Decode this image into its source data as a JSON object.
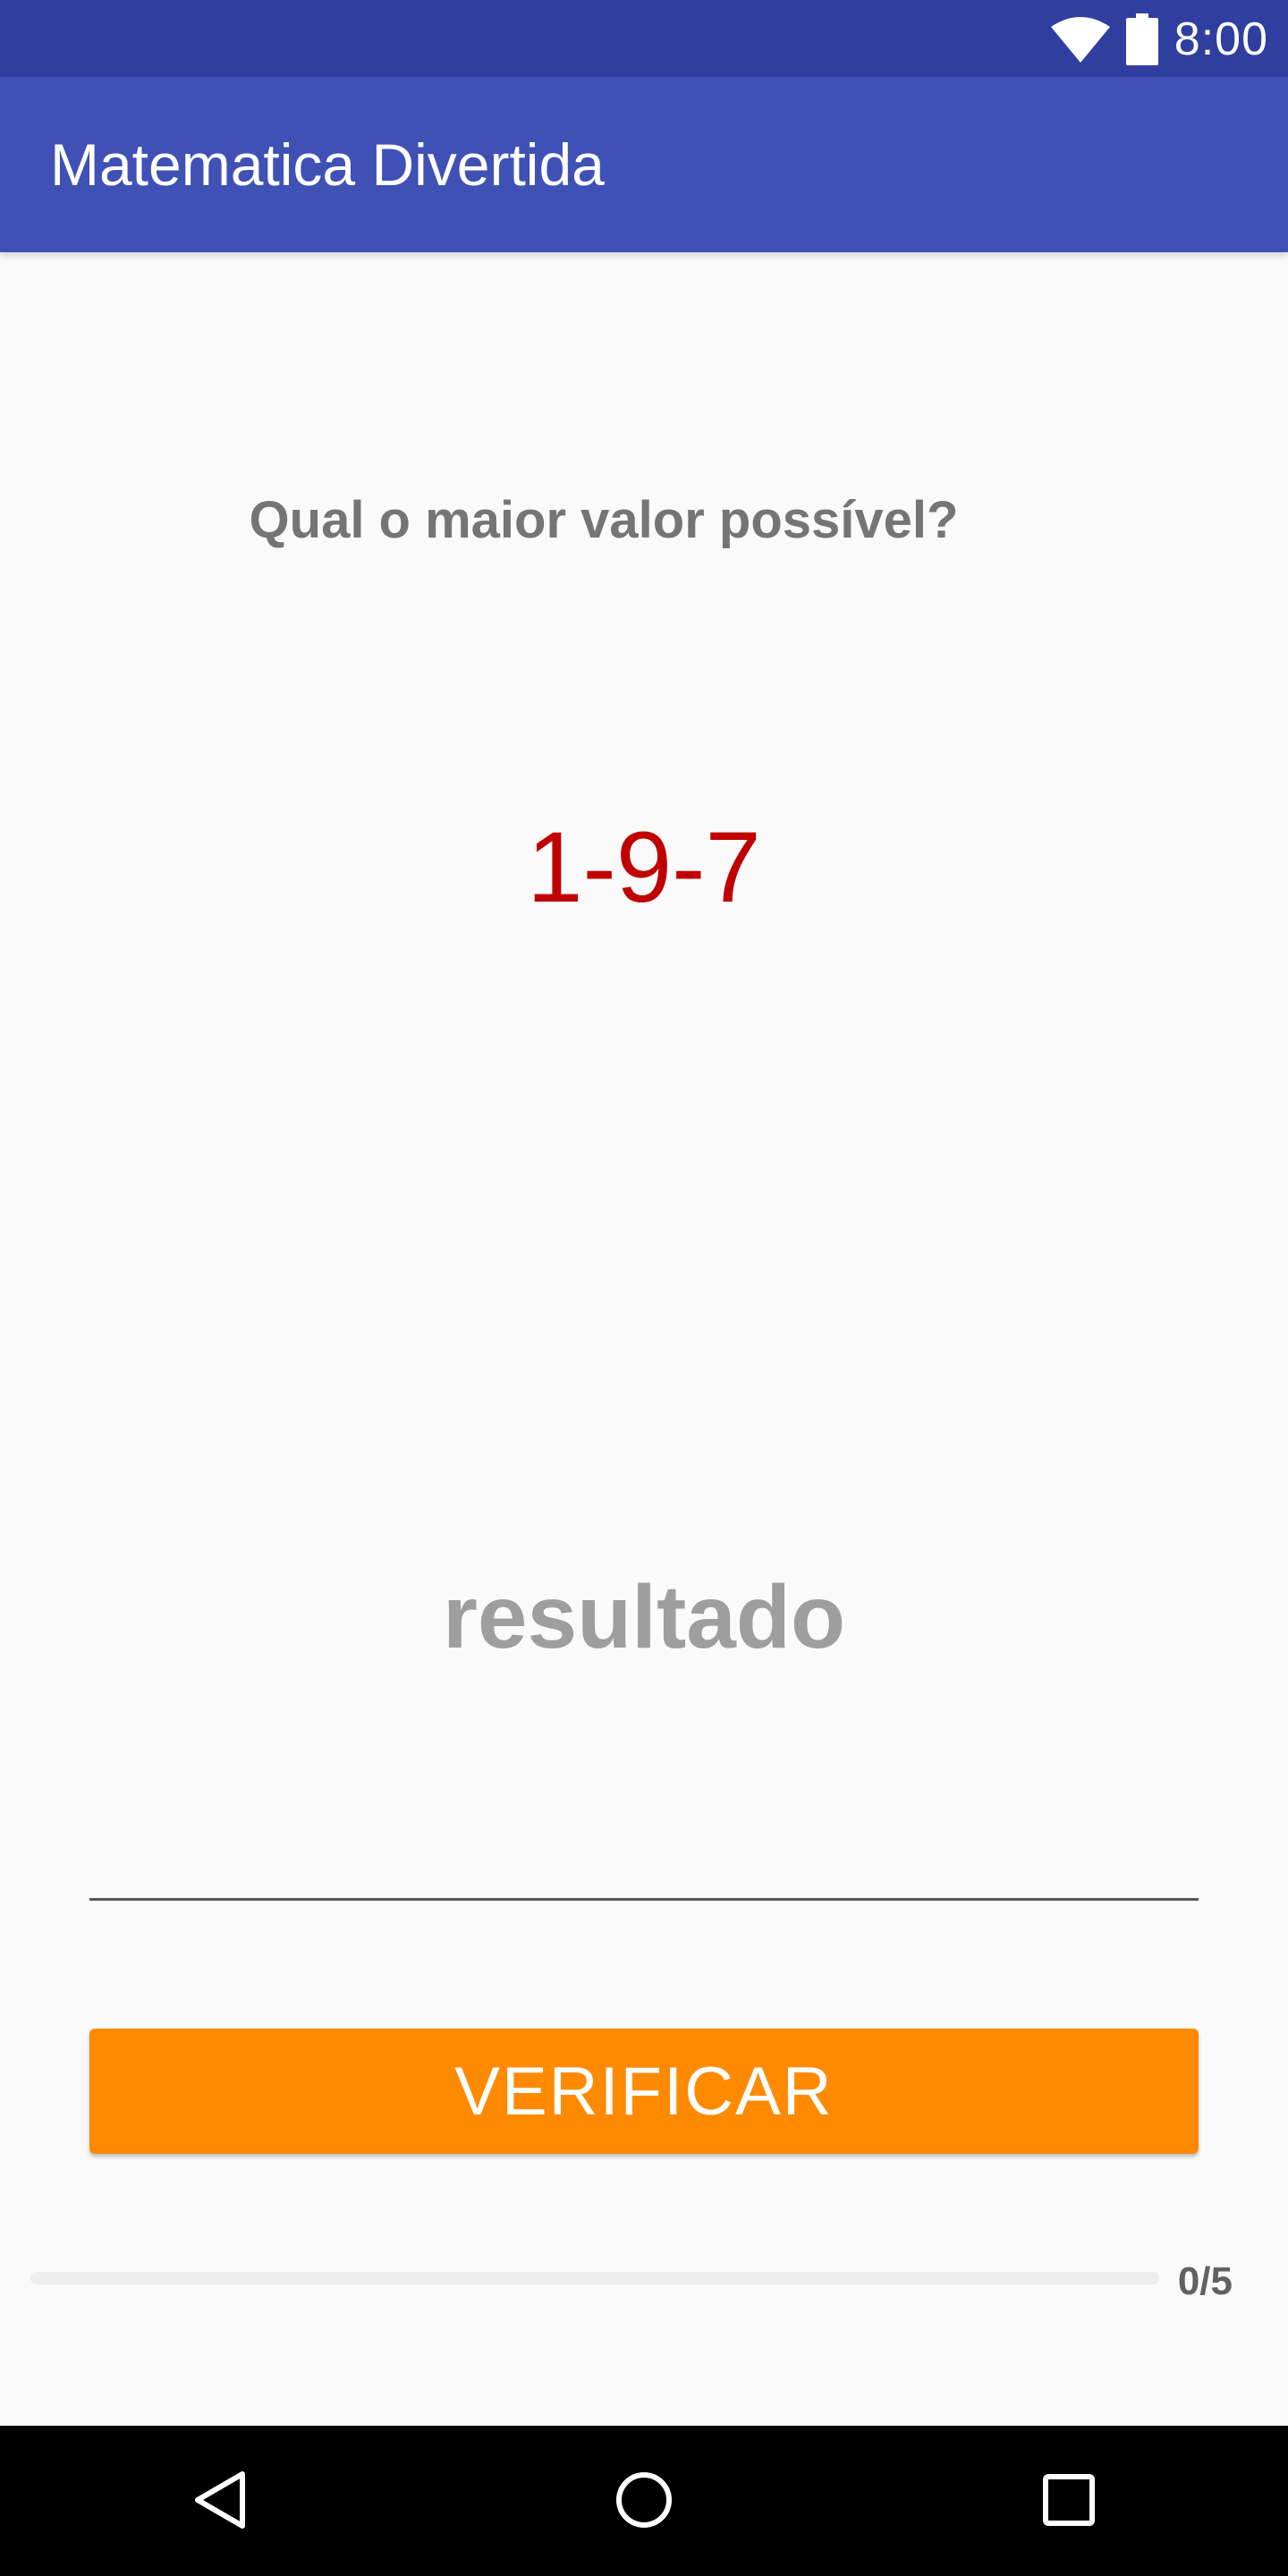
{
  "status_bar": {
    "time": "8:00",
    "icons": [
      "wifi-icon",
      "battery-icon"
    ],
    "color": "#303f9f"
  },
  "app_bar": {
    "title": "Matematica Divertida",
    "color": "#3f51b5"
  },
  "main": {
    "question": "Qual o maior valor possível?",
    "digits": "1-9-7",
    "digits_color": "#c00000",
    "result_input": {
      "value": "",
      "placeholder": "resultado"
    },
    "verify_button_label": "VERIFICAR",
    "accent_color": "#ff8a00",
    "progress": {
      "current": 0,
      "total": 5,
      "label": "0/5",
      "fraction": 0
    }
  },
  "nav_bar": {
    "icons": [
      "back-icon",
      "home-icon",
      "recent-apps-icon"
    ]
  }
}
